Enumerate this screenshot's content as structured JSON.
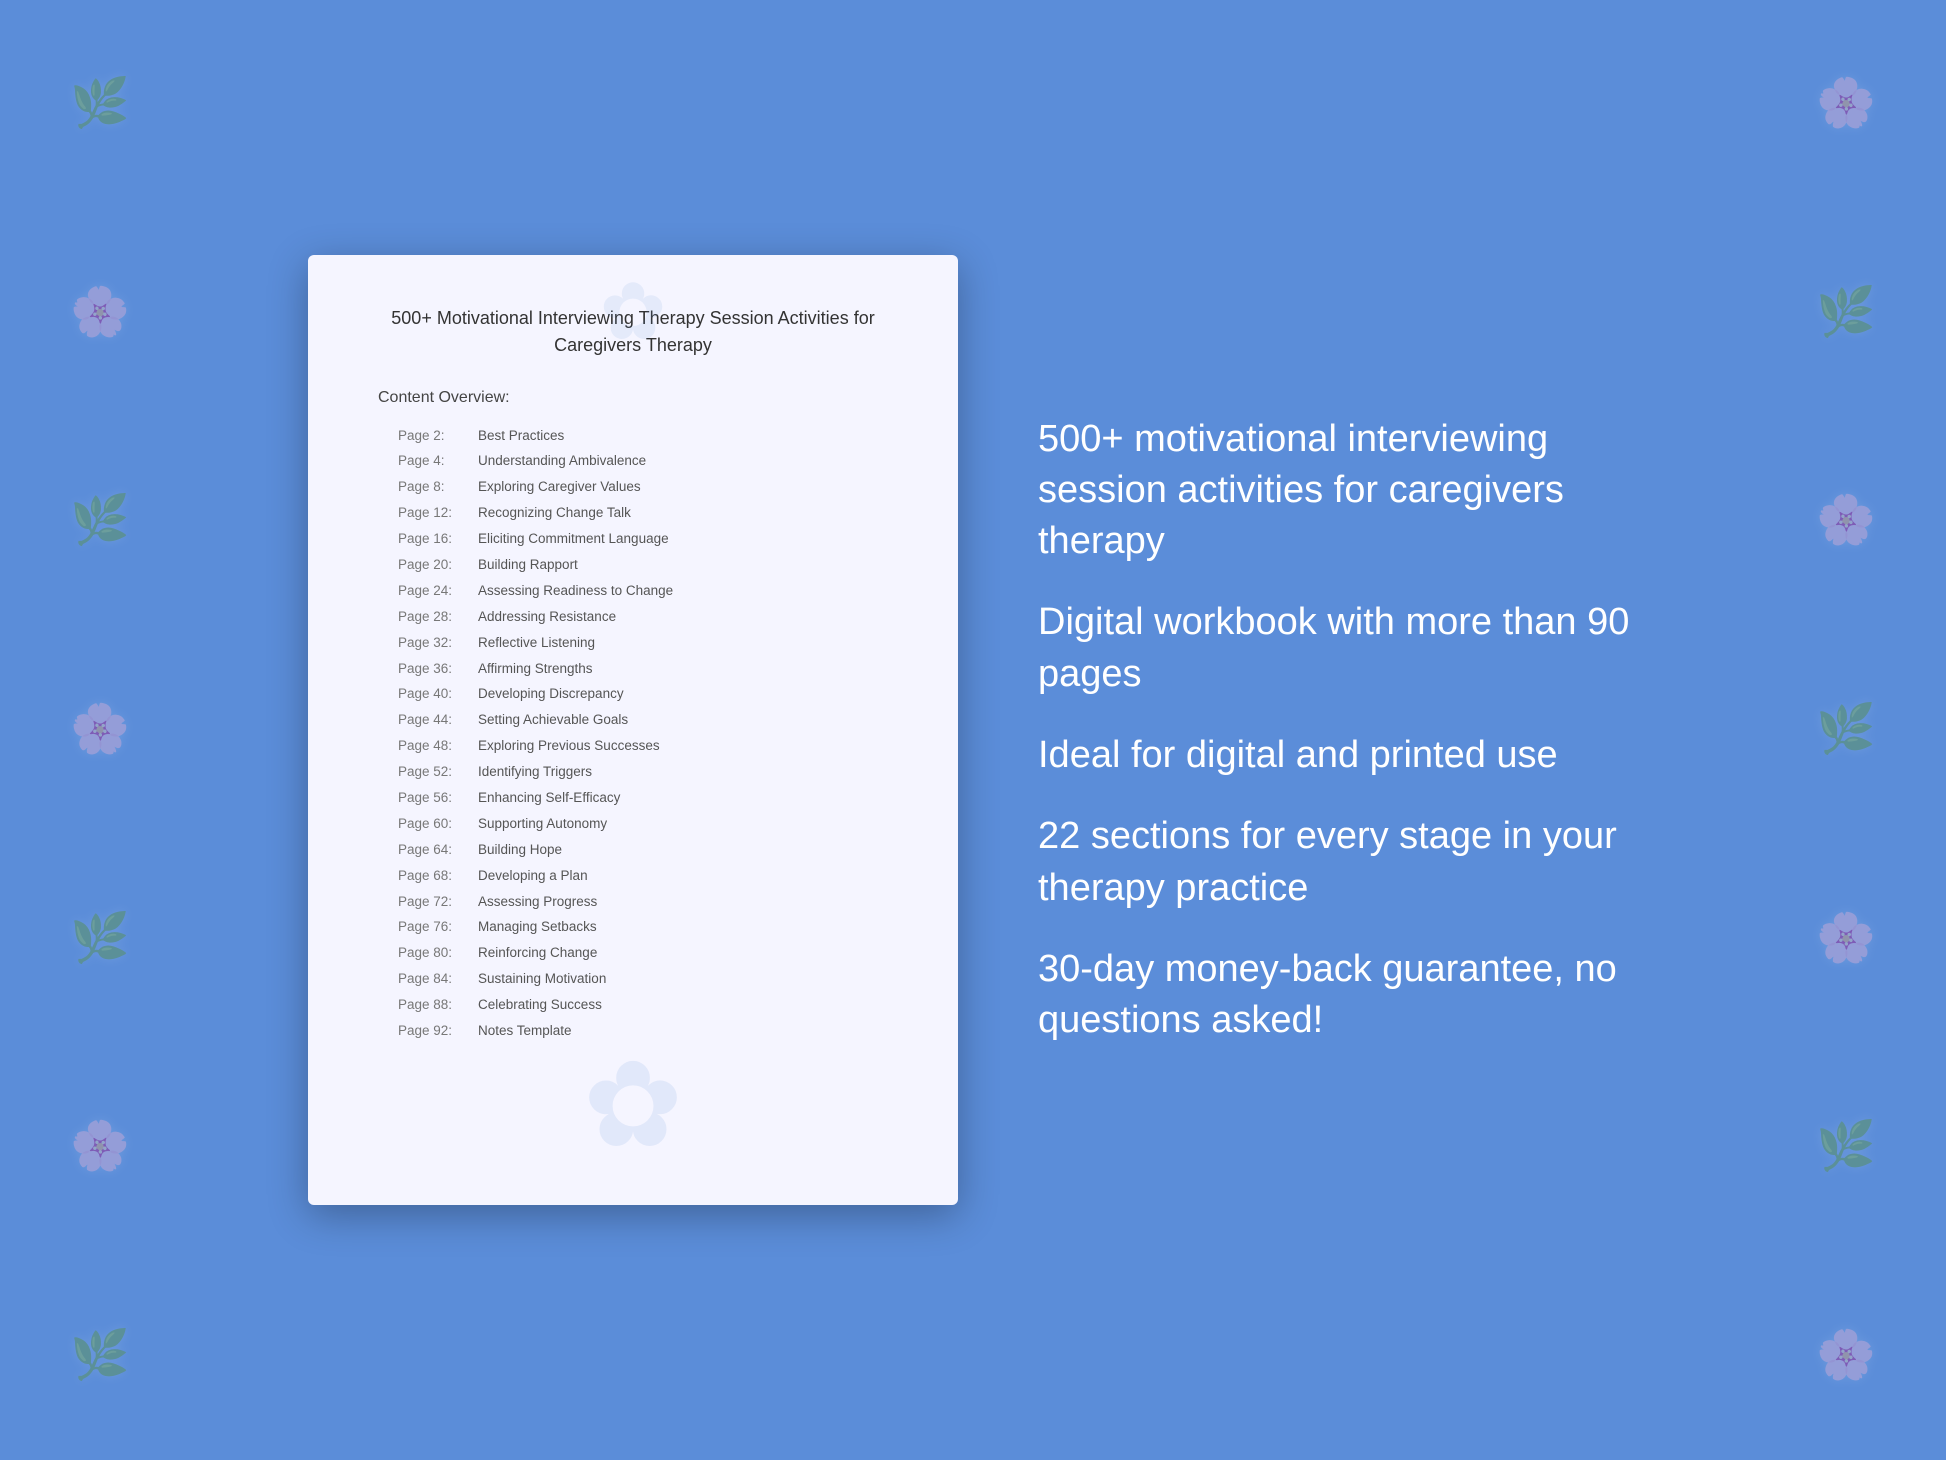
{
  "background_color": "#5b8dd9",
  "book": {
    "title": "500+ Motivational Interviewing Therapy Session Activities for Caregivers Therapy",
    "content_overview_label": "Content Overview:",
    "toc_items": [
      {
        "page": "Page  2:",
        "topic": "Best Practices"
      },
      {
        "page": "Page  4:",
        "topic": "Understanding Ambivalence"
      },
      {
        "page": "Page  8:",
        "topic": "Exploring Caregiver Values"
      },
      {
        "page": "Page 12:",
        "topic": "Recognizing Change Talk"
      },
      {
        "page": "Page 16:",
        "topic": "Eliciting Commitment Language"
      },
      {
        "page": "Page 20:",
        "topic": "Building Rapport"
      },
      {
        "page": "Page 24:",
        "topic": "Assessing Readiness to Change"
      },
      {
        "page": "Page 28:",
        "topic": "Addressing Resistance"
      },
      {
        "page": "Page 32:",
        "topic": "Reflective Listening"
      },
      {
        "page": "Page 36:",
        "topic": "Affirming Strengths"
      },
      {
        "page": "Page 40:",
        "topic": "Developing Discrepancy"
      },
      {
        "page": "Page 44:",
        "topic": "Setting Achievable Goals"
      },
      {
        "page": "Page 48:",
        "topic": "Exploring Previous Successes"
      },
      {
        "page": "Page 52:",
        "topic": "Identifying Triggers"
      },
      {
        "page": "Page 56:",
        "topic": "Enhancing Self-Efficacy"
      },
      {
        "page": "Page 60:",
        "topic": "Supporting Autonomy"
      },
      {
        "page": "Page 64:",
        "topic": "Building Hope"
      },
      {
        "page": "Page 68:",
        "topic": "Developing a Plan"
      },
      {
        "page": "Page 72:",
        "topic": "Assessing Progress"
      },
      {
        "page": "Page 76:",
        "topic": "Managing Setbacks"
      },
      {
        "page": "Page 80:",
        "topic": "Reinforcing Change"
      },
      {
        "page": "Page 84:",
        "topic": "Sustaining Motivation"
      },
      {
        "page": "Page 88:",
        "topic": "Celebrating Success"
      },
      {
        "page": "Page 92:",
        "topic": "Notes Template"
      }
    ]
  },
  "features": [
    "500+ motivational interviewing session activities for caregivers therapy",
    "Digital workbook with more than 90 pages",
    "Ideal for digital and printed use",
    "22 sections for every stage in your therapy practice",
    "30-day money-back guarantee, no questions asked!"
  ],
  "floral_symbols": [
    "❀",
    "✿",
    "❃",
    "✾",
    "❁",
    "✽",
    "❋",
    "✿",
    "❀",
    "✾",
    "❁",
    "✽"
  ]
}
